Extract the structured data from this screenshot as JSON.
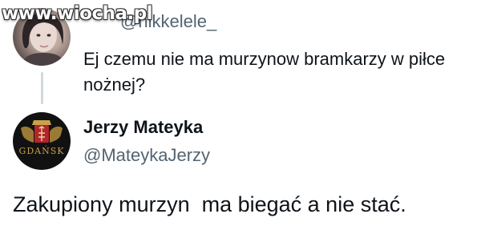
{
  "watermark": {
    "text": "www.wiocha.pl"
  },
  "reply": {
    "handle": "@nikkelele_",
    "text": "Ej czemu nie ma murzynow bramkarzy w piłce nożnej?"
  },
  "author": {
    "name": "Jerzy Mateyka",
    "handle": "@MateykaJerzy",
    "avatar_text": "GDAŃSK"
  },
  "tweet": {
    "text": "Zakupiony murzyn  ma biegać a nie stać."
  },
  "colors": {
    "text": "#0f1419",
    "secondary_text": "#536471",
    "thread_line": "#cfd9de",
    "crest_gold": "#c6a24a"
  }
}
